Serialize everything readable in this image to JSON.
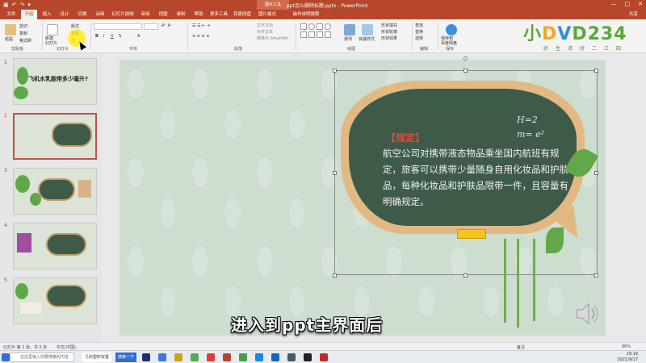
{
  "titlebar": {
    "title": "ppt怎么删除标题.pptx  -  PowerPoint",
    "context_tab": "图片工具",
    "window_controls": [
      "—",
      "□",
      "✕"
    ]
  },
  "tabs": [
    "文件",
    "开始",
    "插入",
    "设计",
    "切换",
    "动画",
    "幻灯片放映",
    "审阅",
    "视图",
    "录制",
    "帮助",
    "更多工具",
    "百度网盘",
    "图片格式",
    "操作说明搜索"
  ],
  "share_label": "共享",
  "ribbon": {
    "clipboard": {
      "paste": "粘贴",
      "cut": "剪切",
      "copy": "复制",
      "format_painter": "格式刷",
      "label": "剪贴板"
    },
    "slides": {
      "new_slide": "新建\n幻灯片",
      "layout": "版式",
      "reset": "重置",
      "section": "节",
      "label": "幻灯片"
    },
    "font": {
      "label": "字体"
    },
    "paragraph": {
      "label": "段落",
      "text_direction": "文字方向",
      "align_text": "对齐文本",
      "smartart": "转换为 SmartArt"
    },
    "drawing": {
      "label": "绘图",
      "arrange": "排列",
      "quick_styles": "快速样式",
      "shape_fill": "形状填充",
      "shape_outline": "形状轮廓",
      "shape_effects": "形状效果"
    },
    "editing": {
      "label": "编辑",
      "find": "查找",
      "replace": "替换",
      "select": "选择"
    },
    "save": {
      "label": "保存",
      "save_to_cloud": "保存到\n百度网盘"
    }
  },
  "logo": {
    "text": "小DVD234",
    "sub": "好生活好二三四"
  },
  "slides_panel": {
    "items": [
      {
        "num": "1",
        "title": "飞机水乳能带多少毫升?"
      },
      {
        "num": "2",
        "title": ""
      },
      {
        "num": "3",
        "title": ""
      },
      {
        "num": "4",
        "title": ""
      },
      {
        "num": "5",
        "title": ""
      }
    ]
  },
  "slide": {
    "rule_title": "【规定】",
    "rule_body": "航空公司对携带液态物品乘坐国内航班有规定，旅客可以携带少量随身自用化妆品和护肤品，每种化妆品和护肤品限带一件，且容量有明确规定。",
    "formula_line1": "H=2",
    "formula_line2": "m= e²"
  },
  "subtitle": "进入到ppt主界面后",
  "statusbar": {
    "slide_info": "幻灯片 第 2 张，共 5 张",
    "language": "中文(中国)",
    "notes": "备注",
    "zoom": "96%"
  },
  "taskbar": {
    "search_placeholder": "在这里输入你要搜索的内容",
    "active_app": "几料塑料安置",
    "inline_label": "搜索一下",
    "time": "19:19",
    "date": "2021/9/17"
  },
  "colors": {
    "titlebar": "#b7472a",
    "board": "#3e5a48",
    "wood": "#e2b983",
    "accent_red": "#e04b3a",
    "leaf": "#61a84a"
  }
}
